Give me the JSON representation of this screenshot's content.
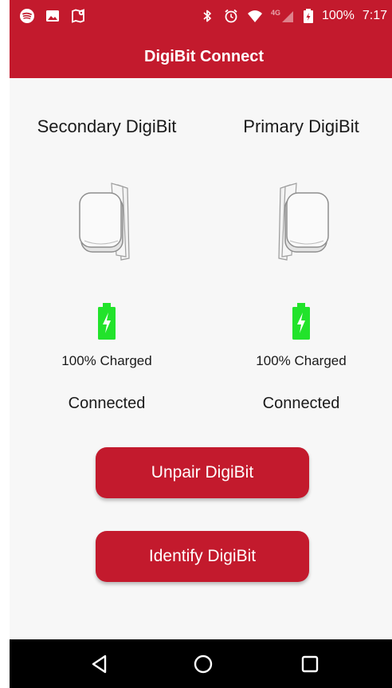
{
  "status_bar": {
    "battery_percent": "100%",
    "time": "7:17",
    "network": "4G",
    "left_icons": [
      "spotify-icon",
      "image-icon",
      "map-pin-icon"
    ],
    "right_icons": [
      "bluetooth-icon",
      "alarm-icon",
      "wifi-icon",
      "signal-icon",
      "battery-charging-icon"
    ]
  },
  "app_bar": {
    "title": "DigiBit Connect"
  },
  "devices": [
    {
      "title": "Secondary DigiBit",
      "charge_text": "100% Charged",
      "connection": "Connected",
      "battery_level": 1.0
    },
    {
      "title": "Primary DigiBit",
      "charge_text": "100% Charged",
      "connection": "Connected",
      "battery_level": 1.0
    }
  ],
  "buttons": {
    "unpair": "Unpair DigiBit",
    "identify": "Identify DigiBit"
  },
  "colors": {
    "brand": "#c31a2d",
    "battery": "#22e32b",
    "background": "#f7f7f7",
    "nav_bar": "#000000"
  },
  "nav_bar": {
    "icons": [
      "back-icon",
      "home-icon",
      "recents-icon"
    ]
  }
}
